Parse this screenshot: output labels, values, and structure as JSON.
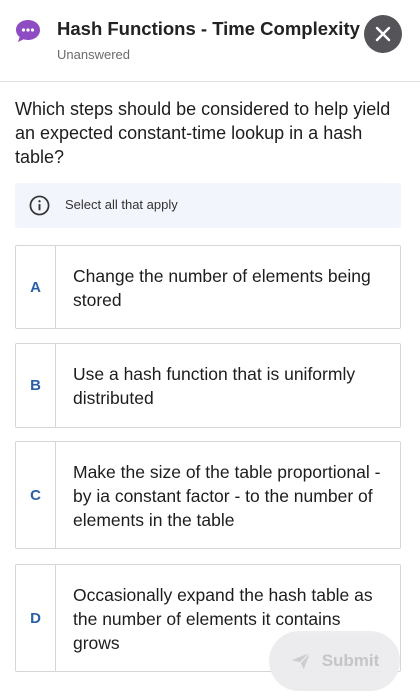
{
  "header": {
    "title": "Hash Functions - Time Complexity",
    "status": "Unanswered",
    "chat_icon": "chat-bubble-icon",
    "close_icon": "close-icon",
    "brand_color": "#8e4cc2"
  },
  "question": {
    "text": "Which steps should be considered to help yield an expected constant-time lookup in a hash table?"
  },
  "hint": {
    "icon": "info-icon",
    "text": "Select all that apply"
  },
  "options": [
    {
      "letter": "A",
      "text": "Change the number of elements being stored"
    },
    {
      "letter": "B",
      "text": "Use a hash function that is uniformly distributed"
    },
    {
      "letter": "C",
      "text": "Make the size of the table proportional - by ia constant factor - to the number of elements in the table"
    },
    {
      "letter": "D",
      "text": "Occasionally expand the hash table as the number of elements it contains grows"
    }
  ],
  "submit": {
    "label": "Submit",
    "icon": "send-icon",
    "enabled": false
  }
}
